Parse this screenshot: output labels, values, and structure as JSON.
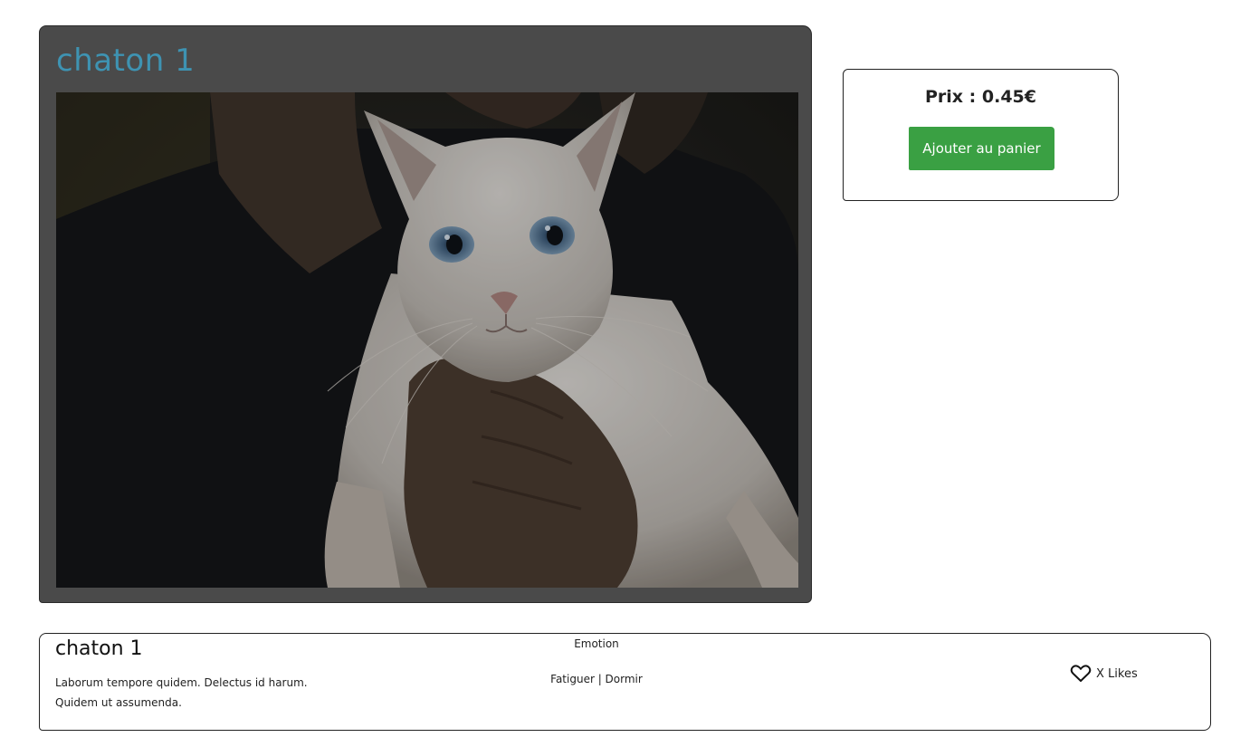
{
  "product": {
    "title": "chaton 1",
    "photo_icon": "cat-photo"
  },
  "purchase": {
    "price_label": "Prix : 0.45€",
    "add_to_cart_label": "Ajouter au panier",
    "accent_color": "#3aa043"
  },
  "info": {
    "name": "chaton 1",
    "description": "Laborum tempore quidem. Delectus id harum. Quidem ut assumenda.",
    "emotion_label": "Emotion",
    "emotion_tags": "Fatiguer | Dormir",
    "likes_label": "X Likes",
    "likes_icon": "heart-icon"
  },
  "colors": {
    "card_bg": "#4a4a4a",
    "title": "#3e93b2"
  }
}
